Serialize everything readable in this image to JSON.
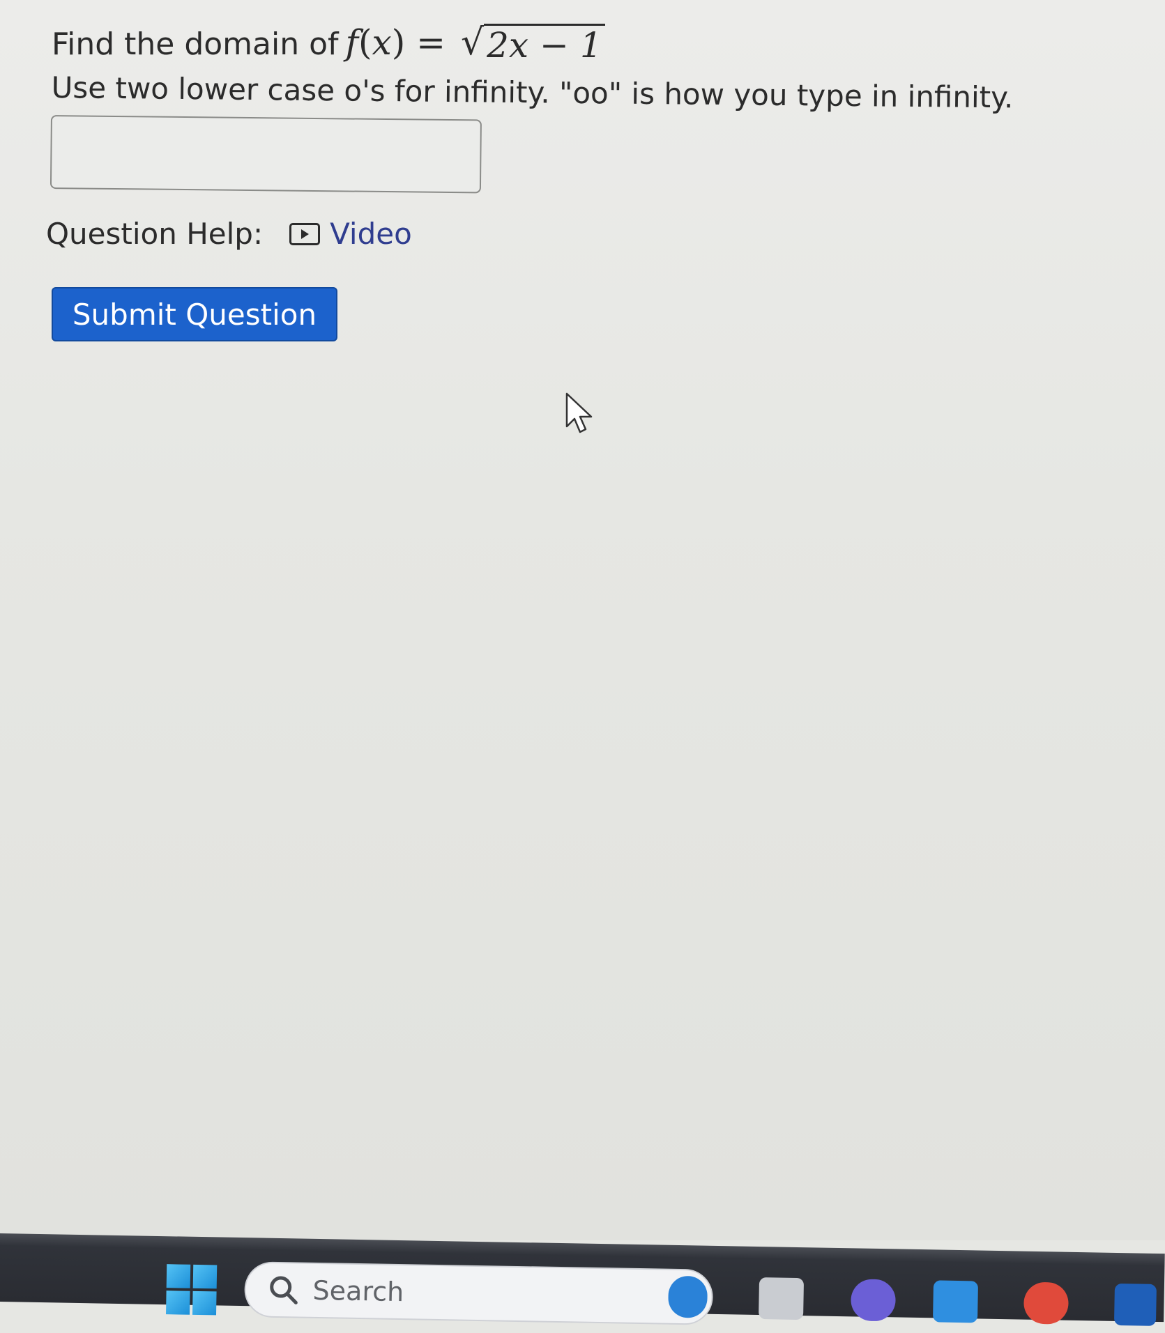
{
  "question": {
    "prefix": "Find the domain of",
    "function_name": "f",
    "variable": "x",
    "radicand": "2x − 1",
    "instruction": "Use two lower case o's for infinity. \"oo\" is how you type in infinity."
  },
  "answer": {
    "value": "",
    "placeholder": ""
  },
  "help": {
    "label": "Question Help:",
    "video_label": "Video"
  },
  "submit": {
    "label": "Submit Question"
  },
  "taskbar": {
    "search_label": "Search"
  },
  "colors": {
    "submit_bg": "#1c62cc",
    "link": "#2f3d8f",
    "page_bg": "#e6e7e3",
    "taskbar_bg": "#2a2c32"
  }
}
